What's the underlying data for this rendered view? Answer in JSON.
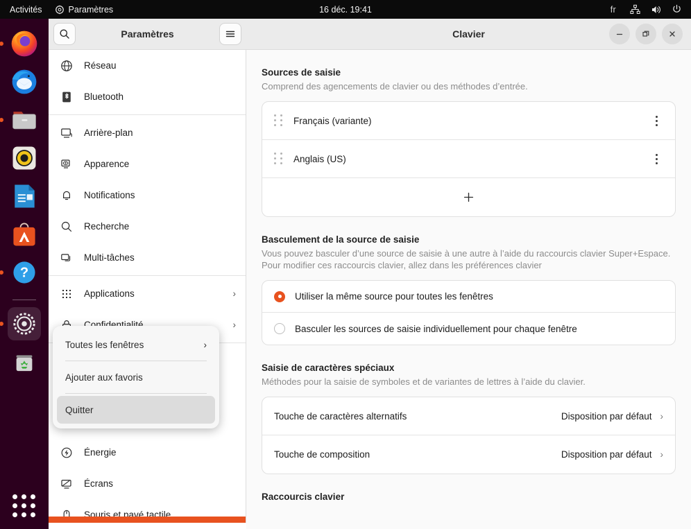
{
  "topbar": {
    "activities": "Activités",
    "app_name": "Paramètres",
    "clock": "16 déc.  19:41",
    "language": "fr",
    "icons": [
      "app-icon",
      "network-icon",
      "volume-icon",
      "power-icon"
    ]
  },
  "dock": {
    "items": [
      {
        "name": "firefox",
        "running": true
      },
      {
        "name": "thunderbird",
        "running": false
      },
      {
        "name": "files",
        "running": true
      },
      {
        "name": "rhythmbox",
        "running": false
      },
      {
        "name": "libreoffice-writer",
        "running": false
      },
      {
        "name": "ubuntu-software",
        "running": false
      },
      {
        "name": "help",
        "running": true
      },
      {
        "name": "settings",
        "running": true
      },
      {
        "name": "trash",
        "running": false
      }
    ],
    "show_apps_label": "Afficher les applications"
  },
  "sidebar": {
    "title": "Paramètres",
    "search_icon": "search-icon",
    "menu_icon": "hamburger-icon",
    "items": [
      {
        "label": "Réseau",
        "icon": "globe-icon",
        "chevron": ""
      },
      {
        "label": "Bluetooth",
        "icon": "bluetooth-icon",
        "chevron": ""
      },
      {
        "label": "Arrière-plan",
        "icon": "wallpaper-icon",
        "chevron": ""
      },
      {
        "label": "Apparence",
        "icon": "appearance-icon",
        "chevron": ""
      },
      {
        "label": "Notifications",
        "icon": "bell-icon",
        "chevron": ""
      },
      {
        "label": "Recherche",
        "icon": "search-icon",
        "chevron": ""
      },
      {
        "label": "Multi-tâches",
        "icon": "multitasking-icon",
        "chevron": ""
      },
      {
        "label": "Applications",
        "icon": "apps-grid-icon",
        "chevron": "›"
      },
      {
        "label": "Confidentialité",
        "icon": "lock-icon",
        "chevron": "›"
      },
      {
        "label": "Énergie",
        "icon": "power-circle-icon",
        "chevron": ""
      },
      {
        "label": "Écrans",
        "icon": "display-icon",
        "chevron": ""
      },
      {
        "label": "Souris et pavé tactile",
        "icon": "mouse-icon",
        "chevron": ""
      }
    ]
  },
  "context_menu": {
    "items": [
      {
        "label": "Toutes les fenêtres",
        "chevron": "›",
        "highlighted": false
      },
      {
        "label": "Ajouter aux favoris",
        "chevron": "",
        "highlighted": false
      },
      {
        "label": "Quitter",
        "chevron": "",
        "highlighted": true
      }
    ]
  },
  "window": {
    "title": "Clavier",
    "controls": {
      "minimize": "minimize-icon",
      "maximize": "maximize-icon",
      "close": "close-icon"
    }
  },
  "main": {
    "sections": [
      {
        "title": "Sources de saisie",
        "subtitle": "Comprend des agencements de clavier ou des méthodes d’entrée."
      },
      {
        "title": "Basculement de la source de saisie",
        "subtitle": "Vous pouvez basculer d’une source de saisie à une autre à l’aide du raccourcis clavier Super+Espace. Pour modifier ces raccourcis clavier, allez dans les préférences clavier"
      },
      {
        "title": "Saisie de caractères spéciaux",
        "subtitle": "Méthodes pour la saisie de symboles et de variantes de lettres à l’aide du clavier."
      },
      {
        "title": "Raccourcis clavier",
        "subtitle": ""
      }
    ],
    "input_sources": [
      {
        "label": "Français (variante)",
        "menu_icon": "three-dots-icon",
        "handle_icon": "drag-handle-icon"
      },
      {
        "label": "Anglais (US)",
        "menu_icon": "three-dots-icon",
        "handle_icon": "drag-handle-icon"
      }
    ],
    "add_source_icon": "plus-icon",
    "switching_options": [
      {
        "label": "Utiliser la même source pour toutes les fenêtres",
        "selected": true
      },
      {
        "label": "Basculer les sources de saisie individuellement pour chaque fenêtre",
        "selected": false
      }
    ],
    "special_chars_rows": [
      {
        "label": "Touche de caractères alternatifs",
        "value": "Disposition par défaut",
        "chevron": "›"
      },
      {
        "label": "Touche de composition",
        "value": "Disposition par défaut",
        "chevron": "›"
      }
    ]
  },
  "colors": {
    "accent": "#e8521f",
    "topbar_bg": "#0b0b0b",
    "dock_bg": "#2c001e",
    "header_bg": "#ebebeb",
    "main_bg": "#fafafa"
  }
}
